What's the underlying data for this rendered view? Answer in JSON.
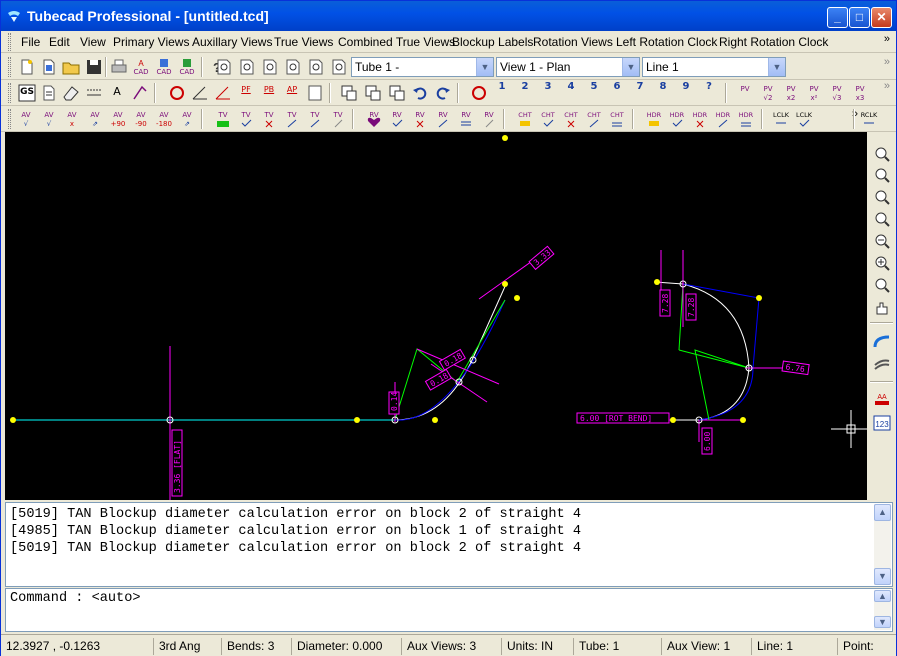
{
  "window": {
    "app_name": "Tubecad Professional",
    "document": " - [untitled.tcd]",
    "minimize": "_",
    "maximize": "□",
    "close": "✕"
  },
  "menu": [
    "File",
    "Edit",
    "View",
    "Primary Views",
    "Auxillary Views",
    "True Views",
    "Combined True Views",
    "Blockup Labels",
    "Rotation Views",
    "Left Rotation Clock",
    "Right Rotation Clock"
  ],
  "overflow_glyph": "»",
  "toolbar1": {
    "tube_select": "Tube 1 -",
    "view_select": "View 1 - Plan",
    "line_select": "Line 1",
    "cad_labels": [
      "CAD",
      "CAD",
      "CAD"
    ]
  },
  "toolbar2": {
    "labels": [
      "GS",
      "A",
      "PF",
      "PB",
      "AP"
    ],
    "numbers": [
      "1",
      "2",
      "3",
      "4",
      "5",
      "6",
      "7",
      "8",
      "9",
      "?"
    ],
    "pv_labels": [
      "PV",
      "PV",
      "PV",
      "PV",
      "PV",
      "PV"
    ],
    "pv_sub": [
      "",
      "√2",
      "x2",
      "x²",
      "√3",
      "x3"
    ]
  },
  "toolbar3": {
    "av_top": [
      "AV",
      "AV",
      "AV",
      "AV",
      "AV",
      "AV",
      "AV",
      "AV"
    ],
    "av_sub": [
      "√",
      "√",
      "x",
      "⇗",
      "+90",
      "-90",
      "-180",
      "⇗"
    ],
    "tv": [
      "TV",
      "TV",
      "TV",
      "TV",
      "TV",
      "TV"
    ],
    "rv": [
      "RV",
      "RV",
      "RV",
      "RV",
      "RV",
      "RV"
    ],
    "cht": [
      "CHT",
      "CHT",
      "CHT",
      "CHT",
      "CHT"
    ],
    "hdr": [
      "HDR",
      "HDR",
      "HDR",
      "HDR",
      "HDR"
    ],
    "lclk": [
      "LCLK",
      "LCLK"
    ],
    "rclk": [
      "RCLK"
    ]
  },
  "canvas_labels": {
    "left_tube_dim1": "3.36 [FLAT]",
    "left_tube_dim2": "0.14",
    "left_tube_dim3": "0.18",
    "left_tube_dim4": "0.18",
    "left_tube_dim5": "3.33",
    "right_tube_dim1": "6.00 [ROT BEND]",
    "right_tube_dim2": "6.00",
    "right_tube_dim3": "7.28",
    "right_tube_dim4": "7.28",
    "right_tube_dim5": "6.76"
  },
  "colors": {
    "canvas_bg": "#000000",
    "tube_line": "#00ffff",
    "label": "#ff00ff",
    "bend": "#0000ff",
    "node": "#ffff00",
    "dim": "#00ff00"
  },
  "messages": [
    "[5019] TAN Blockup diameter calculation error on block 2 of straight 4",
    "[4985] TAN Blockup diameter calculation error on block 1 of straight 4",
    "[5019] TAN Blockup diameter calculation error on block 2 of straight 4"
  ],
  "command": {
    "prompt": "Command : <auto>"
  },
  "status": {
    "coords": "12.3927 , -0.1263",
    "projection": "3rd Ang",
    "bends": "Bends: 3",
    "diameter": "Diameter: 0.000",
    "aux_views": "Aux Views: 3",
    "units": "Units: IN",
    "tube": "Tube: 1",
    "aux_view": "Aux View: 1",
    "line": "Line: 1",
    "point": "Point:"
  }
}
